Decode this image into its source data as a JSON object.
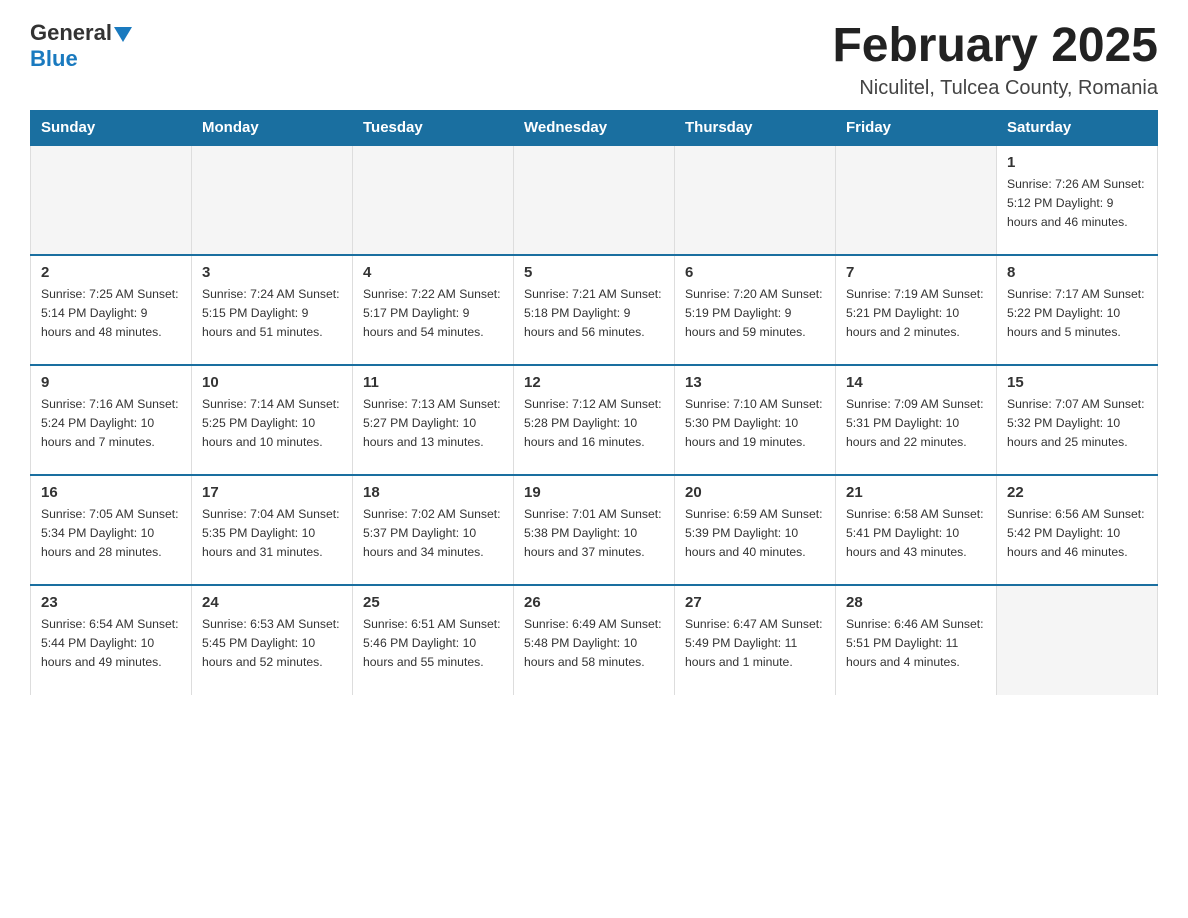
{
  "header": {
    "title": "February 2025",
    "subtitle": "Niculitel, Tulcea County, Romania",
    "logo_general": "General",
    "logo_blue": "Blue"
  },
  "calendar": {
    "days_of_week": [
      "Sunday",
      "Monday",
      "Tuesday",
      "Wednesday",
      "Thursday",
      "Friday",
      "Saturday"
    ],
    "weeks": [
      [
        {
          "day": "",
          "info": ""
        },
        {
          "day": "",
          "info": ""
        },
        {
          "day": "",
          "info": ""
        },
        {
          "day": "",
          "info": ""
        },
        {
          "day": "",
          "info": ""
        },
        {
          "day": "",
          "info": ""
        },
        {
          "day": "1",
          "info": "Sunrise: 7:26 AM\nSunset: 5:12 PM\nDaylight: 9 hours and 46 minutes."
        }
      ],
      [
        {
          "day": "2",
          "info": "Sunrise: 7:25 AM\nSunset: 5:14 PM\nDaylight: 9 hours and 48 minutes."
        },
        {
          "day": "3",
          "info": "Sunrise: 7:24 AM\nSunset: 5:15 PM\nDaylight: 9 hours and 51 minutes."
        },
        {
          "day": "4",
          "info": "Sunrise: 7:22 AM\nSunset: 5:17 PM\nDaylight: 9 hours and 54 minutes."
        },
        {
          "day": "5",
          "info": "Sunrise: 7:21 AM\nSunset: 5:18 PM\nDaylight: 9 hours and 56 minutes."
        },
        {
          "day": "6",
          "info": "Sunrise: 7:20 AM\nSunset: 5:19 PM\nDaylight: 9 hours and 59 minutes."
        },
        {
          "day": "7",
          "info": "Sunrise: 7:19 AM\nSunset: 5:21 PM\nDaylight: 10 hours and 2 minutes."
        },
        {
          "day": "8",
          "info": "Sunrise: 7:17 AM\nSunset: 5:22 PM\nDaylight: 10 hours and 5 minutes."
        }
      ],
      [
        {
          "day": "9",
          "info": "Sunrise: 7:16 AM\nSunset: 5:24 PM\nDaylight: 10 hours and 7 minutes."
        },
        {
          "day": "10",
          "info": "Sunrise: 7:14 AM\nSunset: 5:25 PM\nDaylight: 10 hours and 10 minutes."
        },
        {
          "day": "11",
          "info": "Sunrise: 7:13 AM\nSunset: 5:27 PM\nDaylight: 10 hours and 13 minutes."
        },
        {
          "day": "12",
          "info": "Sunrise: 7:12 AM\nSunset: 5:28 PM\nDaylight: 10 hours and 16 minutes."
        },
        {
          "day": "13",
          "info": "Sunrise: 7:10 AM\nSunset: 5:30 PM\nDaylight: 10 hours and 19 minutes."
        },
        {
          "day": "14",
          "info": "Sunrise: 7:09 AM\nSunset: 5:31 PM\nDaylight: 10 hours and 22 minutes."
        },
        {
          "day": "15",
          "info": "Sunrise: 7:07 AM\nSunset: 5:32 PM\nDaylight: 10 hours and 25 minutes."
        }
      ],
      [
        {
          "day": "16",
          "info": "Sunrise: 7:05 AM\nSunset: 5:34 PM\nDaylight: 10 hours and 28 minutes."
        },
        {
          "day": "17",
          "info": "Sunrise: 7:04 AM\nSunset: 5:35 PM\nDaylight: 10 hours and 31 minutes."
        },
        {
          "day": "18",
          "info": "Sunrise: 7:02 AM\nSunset: 5:37 PM\nDaylight: 10 hours and 34 minutes."
        },
        {
          "day": "19",
          "info": "Sunrise: 7:01 AM\nSunset: 5:38 PM\nDaylight: 10 hours and 37 minutes."
        },
        {
          "day": "20",
          "info": "Sunrise: 6:59 AM\nSunset: 5:39 PM\nDaylight: 10 hours and 40 minutes."
        },
        {
          "day": "21",
          "info": "Sunrise: 6:58 AM\nSunset: 5:41 PM\nDaylight: 10 hours and 43 minutes."
        },
        {
          "day": "22",
          "info": "Sunrise: 6:56 AM\nSunset: 5:42 PM\nDaylight: 10 hours and 46 minutes."
        }
      ],
      [
        {
          "day": "23",
          "info": "Sunrise: 6:54 AM\nSunset: 5:44 PM\nDaylight: 10 hours and 49 minutes."
        },
        {
          "day": "24",
          "info": "Sunrise: 6:53 AM\nSunset: 5:45 PM\nDaylight: 10 hours and 52 minutes."
        },
        {
          "day": "25",
          "info": "Sunrise: 6:51 AM\nSunset: 5:46 PM\nDaylight: 10 hours and 55 minutes."
        },
        {
          "day": "26",
          "info": "Sunrise: 6:49 AM\nSunset: 5:48 PM\nDaylight: 10 hours and 58 minutes."
        },
        {
          "day": "27",
          "info": "Sunrise: 6:47 AM\nSunset: 5:49 PM\nDaylight: 11 hours and 1 minute."
        },
        {
          "day": "28",
          "info": "Sunrise: 6:46 AM\nSunset: 5:51 PM\nDaylight: 11 hours and 4 minutes."
        },
        {
          "day": "",
          "info": ""
        }
      ]
    ]
  }
}
